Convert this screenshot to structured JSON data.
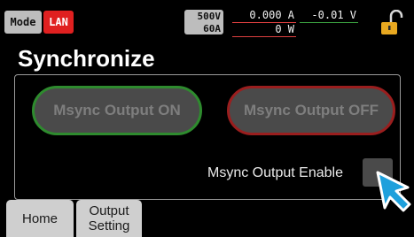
{
  "status": {
    "mode_label": "Mode",
    "interface_label": "LAN",
    "rating_voltage": "500V",
    "rating_current": "60A",
    "current_readout": "0.000 A",
    "voltage_readout": "-0.01 V",
    "power_readout": "0 W",
    "colors": {
      "interface_bg": "#e02020",
      "current_line": "#e04040",
      "voltage_line": "#3aa040"
    },
    "lock_icon": "padlock-open-icon"
  },
  "page": {
    "title": "Synchronize"
  },
  "controls": {
    "msync_on_label": "Msync Output ON",
    "msync_off_label": "Msync Output OFF",
    "msync_on_accent": "#2e8b2e",
    "msync_off_accent": "#9a1e1e",
    "enable_label": "Msync Output Enable",
    "enable_checked": false
  },
  "pointer": {
    "icon": "pointer-arrow-icon",
    "color": "#1ea0dc"
  },
  "tabs": {
    "home": "Home",
    "output_setting_line1": "Output",
    "output_setting_line2": "Setting"
  }
}
